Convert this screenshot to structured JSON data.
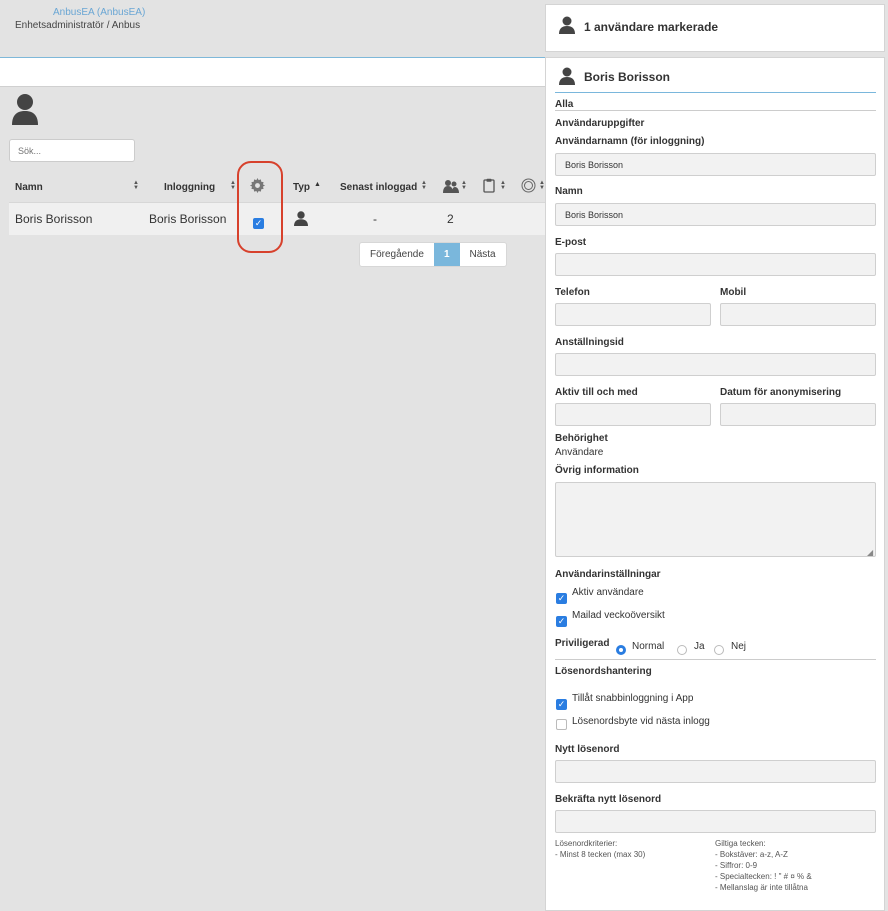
{
  "header": {
    "app_link": "AnbusEA (AnbusEA)",
    "role": "Enhetsadministratör / Anbus"
  },
  "search": {
    "placeholder": "Sök..."
  },
  "table": {
    "columns": [
      "Namn",
      "Inloggning",
      "Typ",
      "Senast inloggad"
    ],
    "rows": [
      {
        "name": "Boris Borisson",
        "login": "Boris Borisson",
        "selected": true,
        "last_login": "-",
        "count": "2"
      }
    ]
  },
  "pagination": {
    "prev": "Föregående",
    "current": "1",
    "next": "Nästa"
  },
  "selection_panel": {
    "title": "1 användare markerade"
  },
  "user_panel": {
    "title": "Boris Borisson",
    "tab_all": "Alla",
    "section_user_data": "Användaruppgifter",
    "username_label": "Användarnamn (för inloggning)",
    "username_value": "Boris Borisson",
    "name_label": "Namn",
    "name_value": "Boris Borisson",
    "email_label": "E-post",
    "email_value": "",
    "phone_label": "Telefon",
    "phone_value": "",
    "mobile_label": "Mobil",
    "mobile_value": "",
    "employee_id_label": "Anställningsid",
    "employee_id_value": "",
    "active_until_label": "Aktiv till och med",
    "active_until_value": "",
    "anonymize_label": "Datum för anonymisering",
    "anonymize_value": "",
    "permission_label": "Behörighet",
    "permission_value": "Användare",
    "other_info_label": "Övrig information",
    "other_info_value": "",
    "settings_title": "Användarinställningar",
    "active_user_label": "Aktiv användare",
    "active_user_checked": true,
    "weekly_mail_label": "Mailad veckoöversikt",
    "weekly_mail_checked": true,
    "privileged_label": "Priviligerad",
    "privileged_options": [
      "Normal",
      "Ja",
      "Nej"
    ],
    "privileged_selected": "Normal",
    "password_title": "Lösenordshantering",
    "quick_login_label": "Tillåt snabbinloggning i App",
    "quick_login_checked": true,
    "change_next_label": "Lösenordsbyte vid nästa inlogg",
    "change_next_checked": false,
    "new_password_label": "Nytt lösenord",
    "new_password_value": "",
    "confirm_password_label": "Bekräfta nytt lösenord",
    "confirm_password_value": "",
    "criteria_title": "Lösenordkriterier:",
    "criteria_lines": [
      "- Minst 8 tecken (max 30)"
    ],
    "valid_chars_title": "Giltiga tecken:",
    "valid_chars_lines": [
      "- Bokstäver: a-z, A-Z",
      "- Siffror: 0-9",
      "- Specialtecken: ! \" # ¤ % &",
      "- Mellanslag är inte tillåtna"
    ]
  }
}
